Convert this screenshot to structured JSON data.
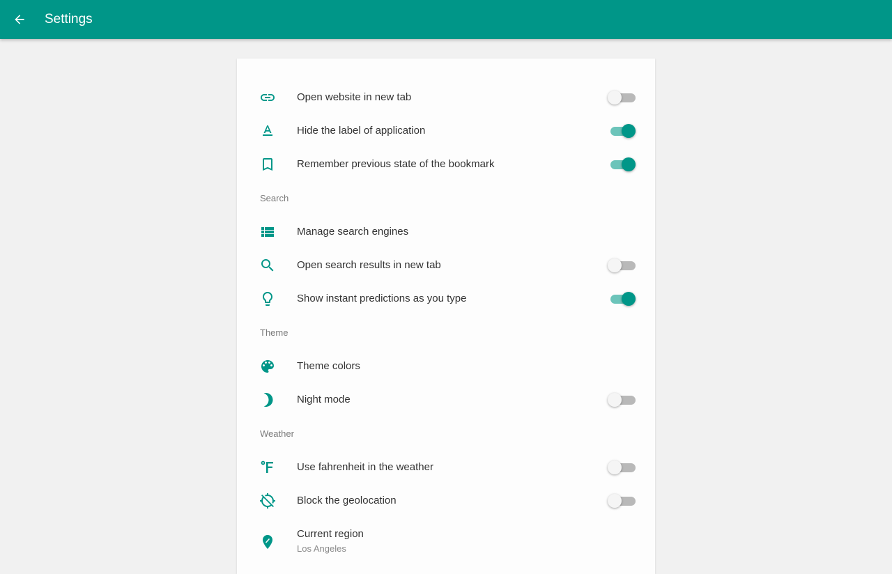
{
  "header": {
    "title": "Settings",
    "back_icon": "arrow-back-icon"
  },
  "colors": {
    "accent": "#009688",
    "background": "#f1f1f1",
    "card": "#fdfdfd"
  },
  "general": [
    {
      "label": "Open website in new tab",
      "icon": "link-icon",
      "toggle": false
    },
    {
      "label": "Hide the label of application",
      "icon": "text-format-icon",
      "toggle": true
    },
    {
      "label": "Remember previous state of the bookmark",
      "icon": "bookmark-icon",
      "toggle": true
    }
  ],
  "search": {
    "header": "Search",
    "items": [
      {
        "label": "Manage search engines",
        "icon": "list-icon"
      },
      {
        "label": "Open search results in new tab",
        "icon": "search-icon",
        "toggle": false
      },
      {
        "label": "Show instant predictions as you type",
        "icon": "lightbulb-icon",
        "toggle": true
      }
    ]
  },
  "theme": {
    "header": "Theme",
    "items": [
      {
        "label": "Theme colors",
        "icon": "palette-icon"
      },
      {
        "label": "Night mode",
        "icon": "moon-icon",
        "toggle": false
      }
    ]
  },
  "weather": {
    "header": "Weather",
    "items": [
      {
        "label": "Use fahrenheit in the weather",
        "icon": "fahrenheit-icon",
        "toggle": false
      },
      {
        "label": "Block the geolocation",
        "icon": "location-disabled-icon",
        "toggle": false
      },
      {
        "label": "Current region",
        "sublabel": "Los Angeles",
        "icon": "place-icon"
      }
    ]
  }
}
